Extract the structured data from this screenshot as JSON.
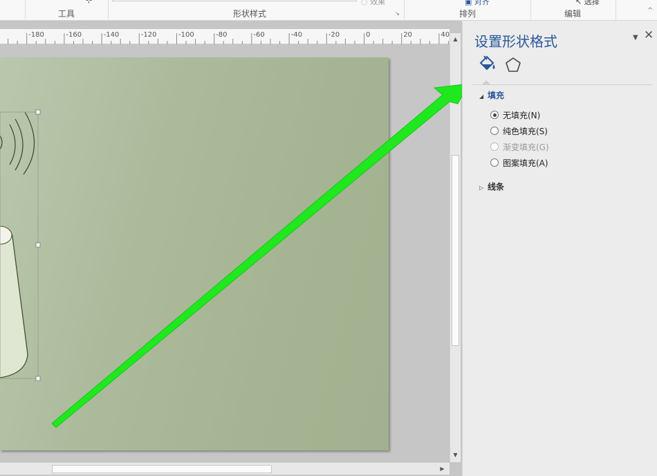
{
  "ribbon": {
    "groups": [
      {
        "label": "工具"
      },
      {
        "label": "形状样式"
      },
      {
        "label": "排列"
      },
      {
        "label": "编辑"
      }
    ]
  },
  "ruler": {
    "ticks": [
      "00",
      "-180",
      "-160",
      "-140",
      "-120",
      "-100",
      "-80",
      "-60",
      "-40",
      "-20",
      "0",
      "20",
      "40"
    ]
  },
  "pane": {
    "title": "设置形状格式",
    "tabs": [
      {
        "name": "fill-and-line",
        "icon": "paint-bucket-icon"
      },
      {
        "name": "effects",
        "icon": "pentagon-icon"
      }
    ],
    "fill_section": {
      "label": "填充",
      "options": [
        {
          "label": "无填充(N)",
          "checked": true,
          "disabled": false
        },
        {
          "label": "纯色填充(S)",
          "checked": false,
          "disabled": false
        },
        {
          "label": "渐变填充(G)",
          "checked": false,
          "disabled": true
        },
        {
          "label": "图案填充(A)",
          "checked": false,
          "disabled": false
        }
      ]
    },
    "line_section": {
      "label": "线条"
    }
  },
  "colors": {
    "accent": "#2b579a",
    "arrow": "#1fe81f",
    "page": "#a8b796"
  }
}
